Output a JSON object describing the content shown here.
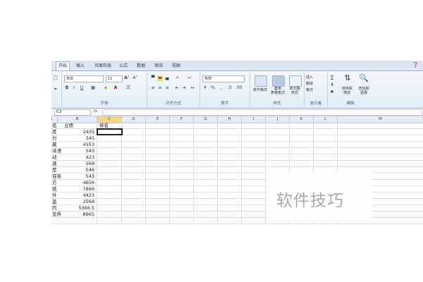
{
  "tabs": [
    "开始",
    "插入",
    "页面布局",
    "公式",
    "数据",
    "审阅",
    "视图"
  ],
  "ribbon": {
    "font_name": "宋体",
    "font_size": "11",
    "number_format": "常规",
    "cond_format": "条件格式",
    "table_format": "套用\n表格格式",
    "cell_style": "单元格\n样式",
    "insert": "插入",
    "delete": "删除",
    "format": "格式",
    "sort_filter": "排序和\n筛选",
    "find_select": "查找和\n选择",
    "group_labels": [
      "字体",
      "对齐方式",
      "数字",
      "样式",
      "单元格",
      "编辑"
    ]
  },
  "formula_bar": {
    "name_box": "C2",
    "fx": "fx",
    "value": ""
  },
  "columns": [
    "A",
    "B",
    "C",
    "D",
    "E",
    "F",
    "G",
    "H",
    "I",
    "J",
    "K",
    "L",
    "M"
  ],
  "cells": {
    "a1": "名",
    "b1": "业绩",
    "c1": "排名",
    "rows": [
      {
        "a": "度",
        "b": "2435"
      },
      {
        "a": "付",
        "b": "345"
      },
      {
        "a": "晨",
        "b": "4553"
      },
      {
        "a": "泽溥",
        "b": "543"
      },
      {
        "a": "动",
        "b": "423"
      },
      {
        "a": "速",
        "b": "568"
      },
      {
        "a": "是",
        "b": "546"
      },
      {
        "a": "容易",
        "b": "543"
      },
      {
        "a": "方",
        "b": "4656"
      },
      {
        "a": "纸",
        "b": "7866"
      },
      {
        "a": "件",
        "b": "4423"
      },
      {
        "a": "盖",
        "b": "2568"
      },
      {
        "a": "的",
        "b": "5366.5"
      },
      {
        "a": "悲界",
        "b": "8965"
      }
    ]
  },
  "watermark": "软件技巧",
  "colors": {
    "tab_bg": "#dbe5f1",
    "ribbon_bg": "#e2ebf6",
    "header_bg": "#e4ebf4"
  }
}
